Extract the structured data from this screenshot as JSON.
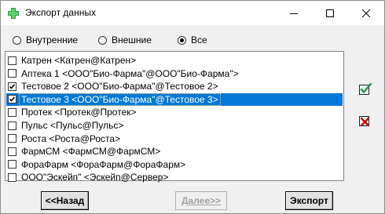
{
  "window": {
    "title": "Экспорт данных"
  },
  "filter": {
    "options": [
      {
        "label": "Внутренние",
        "checked": false
      },
      {
        "label": "Внешние",
        "checked": false
      },
      {
        "label": "Все",
        "checked": true
      }
    ]
  },
  "list": {
    "items": [
      {
        "text": "Катрен <Катрен@Катрен>",
        "checked": false,
        "selected": false
      },
      {
        "text": "Аптека 1 <ООО\"Био-Фарма\"@ООО\"Био-Фарма\">",
        "checked": false,
        "selected": false
      },
      {
        "text": "Тестовое 2 <ООО\"Био-Фарма\"@Тестовое 2>",
        "checked": true,
        "selected": false
      },
      {
        "text": "Тестовое 3 <ООО\"Био-Фарма\"@Тестовое 3>",
        "checked": true,
        "selected": true
      },
      {
        "text": "Протек <Протек@Протек>",
        "checked": false,
        "selected": false
      },
      {
        "text": "Пульс <Пульс@Пульс>",
        "checked": false,
        "selected": false
      },
      {
        "text": "Роста <Роста@Роста>",
        "checked": false,
        "selected": false
      },
      {
        "text": "ФармСМ <ФармСМ@ФармСМ>",
        "checked": false,
        "selected": false
      },
      {
        "text": "ФораФарм <ФораФарм@ФораФарм>",
        "checked": false,
        "selected": false
      },
      {
        "text": "ООО\"Эскейп\" <Эскейп@Сервер>",
        "checked": false,
        "selected": false
      }
    ]
  },
  "buttons": {
    "back": "<<Назад",
    "next": "Далее>>",
    "export": "Экспорт"
  },
  "colors": {
    "selection": "#0078d7",
    "check_icon": "#2e8b57",
    "uncheck_icon": "#c00000"
  }
}
